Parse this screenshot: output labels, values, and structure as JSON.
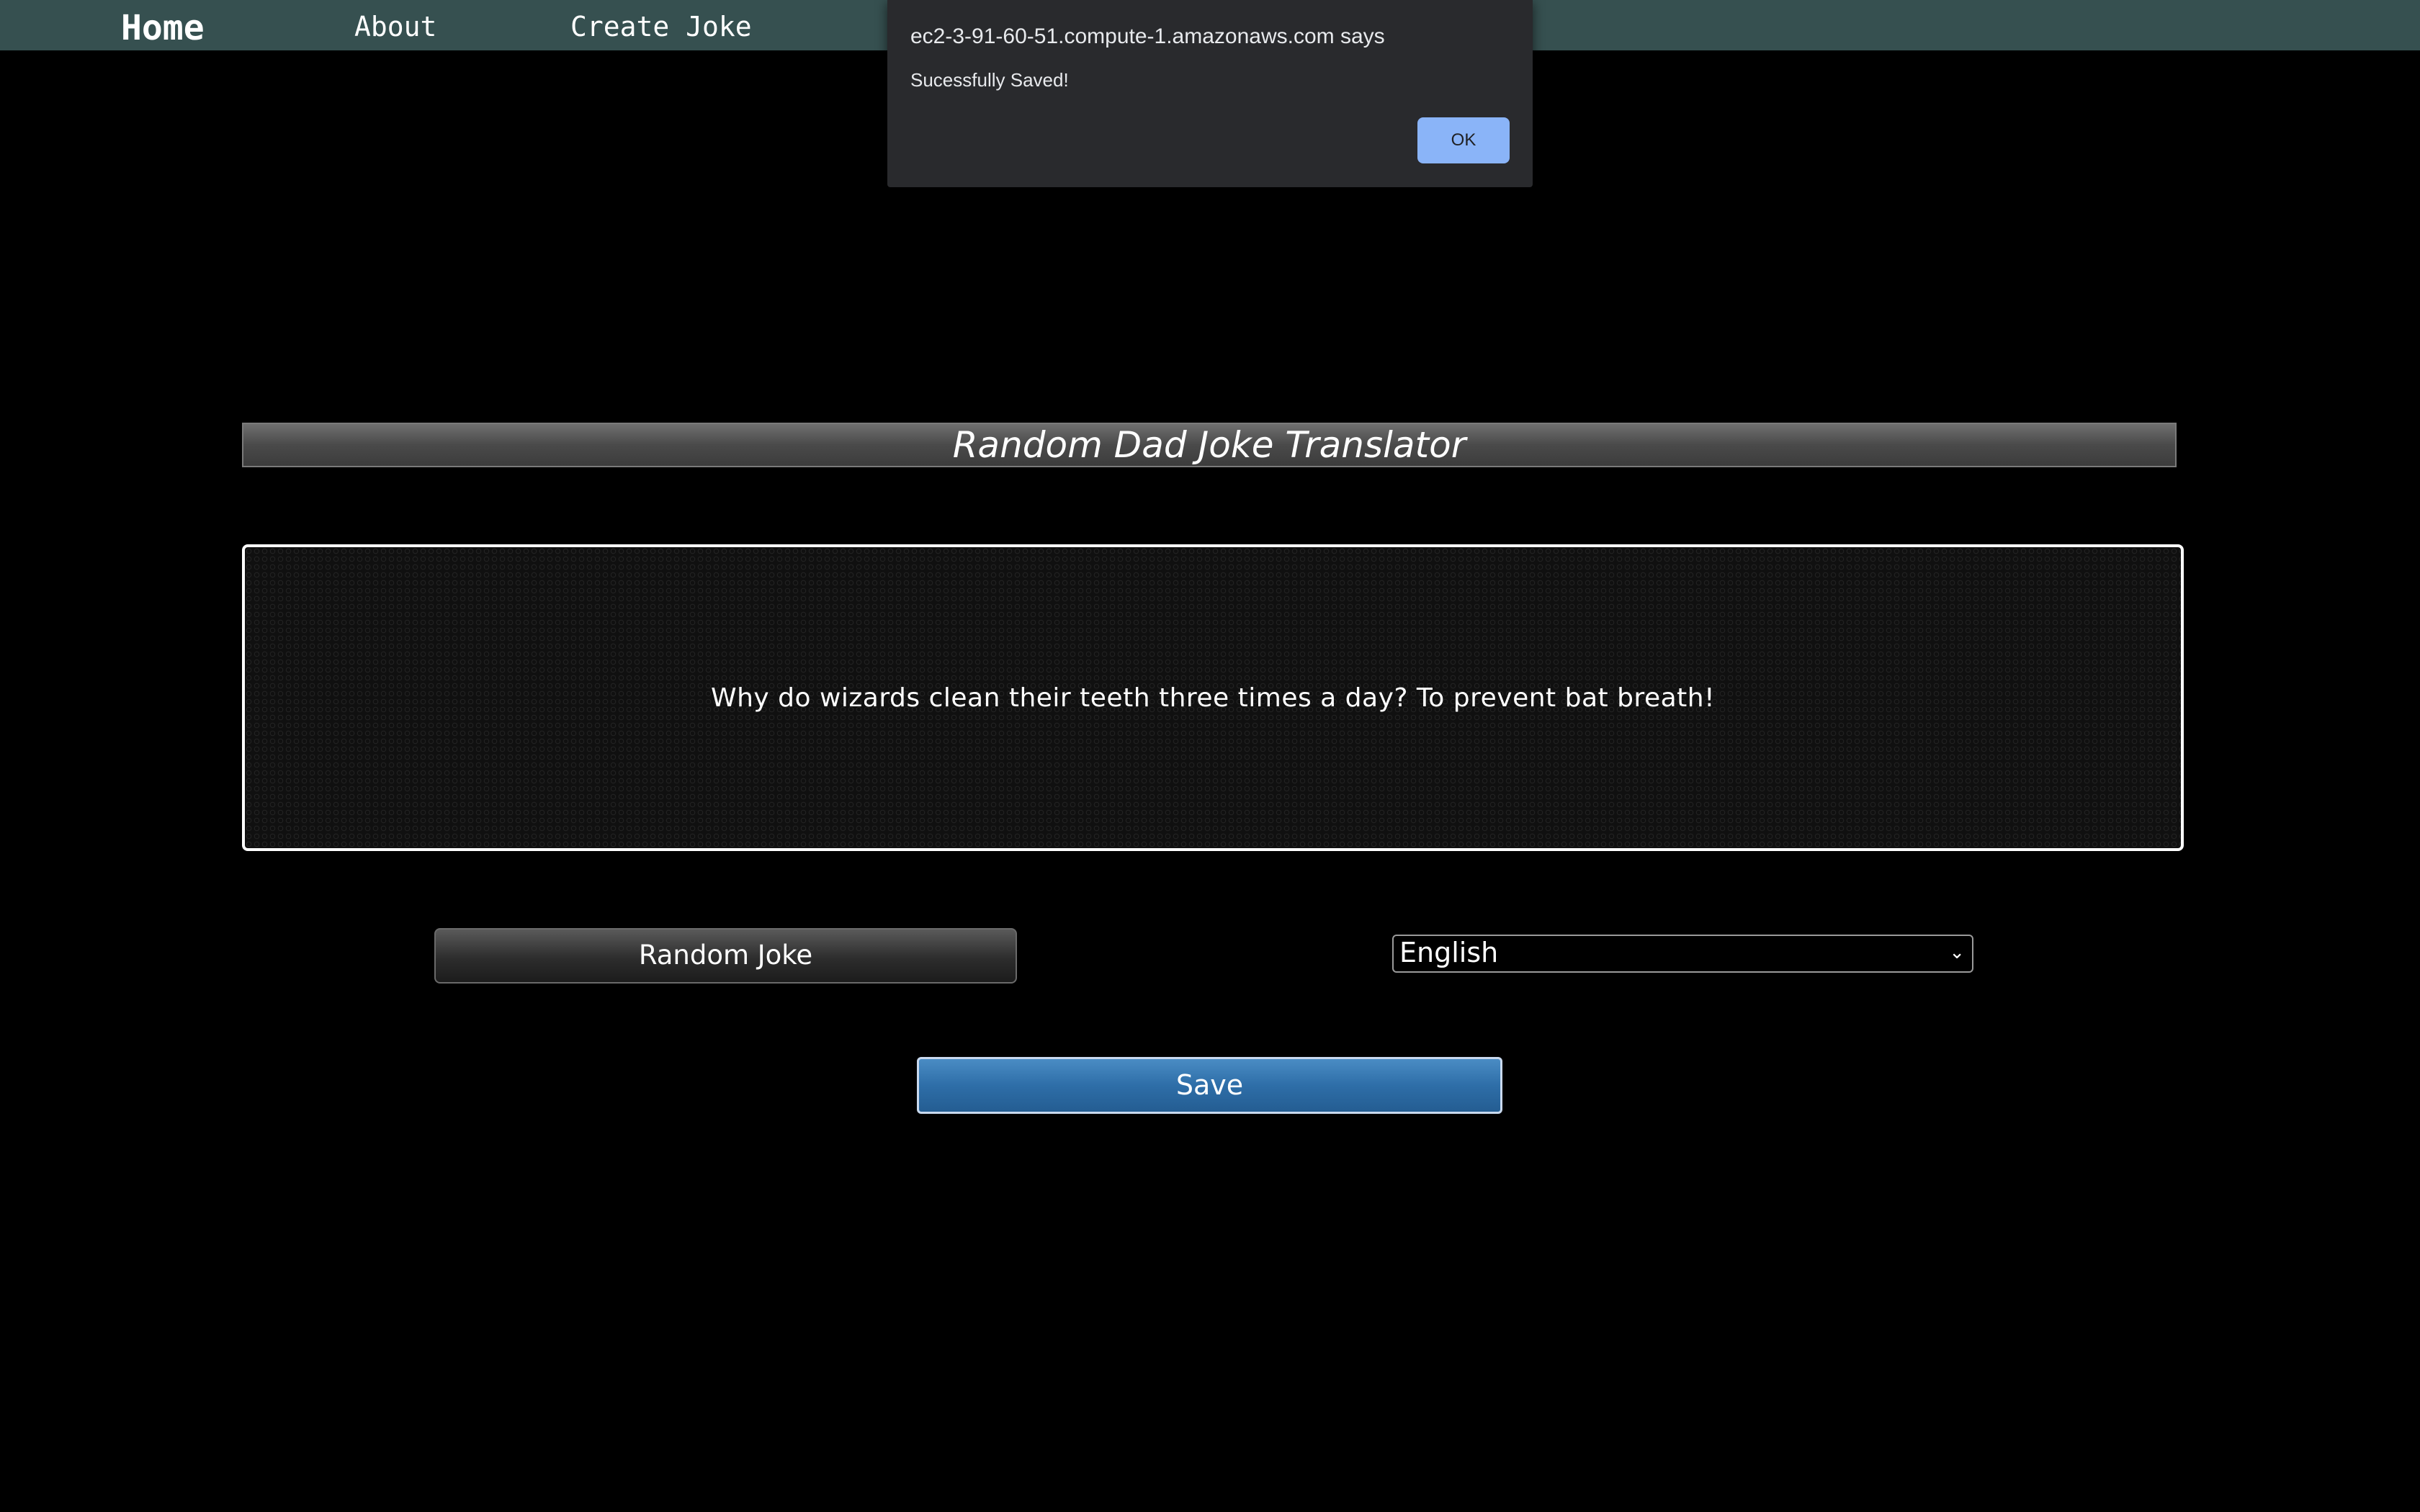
{
  "nav": {
    "home": "Home",
    "about": "About",
    "create_joke": "Create Joke"
  },
  "main": {
    "title": "Random Dad Joke Translator",
    "joke_text": "Why do wizards clean their teeth three times a day? To prevent bat breath!",
    "random_button_label": "Random Joke",
    "language_selected": "English",
    "save_button_label": "Save"
  },
  "dialog": {
    "origin": "ec2-3-91-60-51.compute-1.amazonaws.com says",
    "message": "Sucessfully Saved!",
    "ok_label": "OK"
  },
  "colors": {
    "navbar_bg": "#365050",
    "page_bg": "#000000",
    "save_button": "#2e6ea8",
    "dialog_bg": "#292a2d",
    "dialog_ok": "#8ab4f8"
  }
}
